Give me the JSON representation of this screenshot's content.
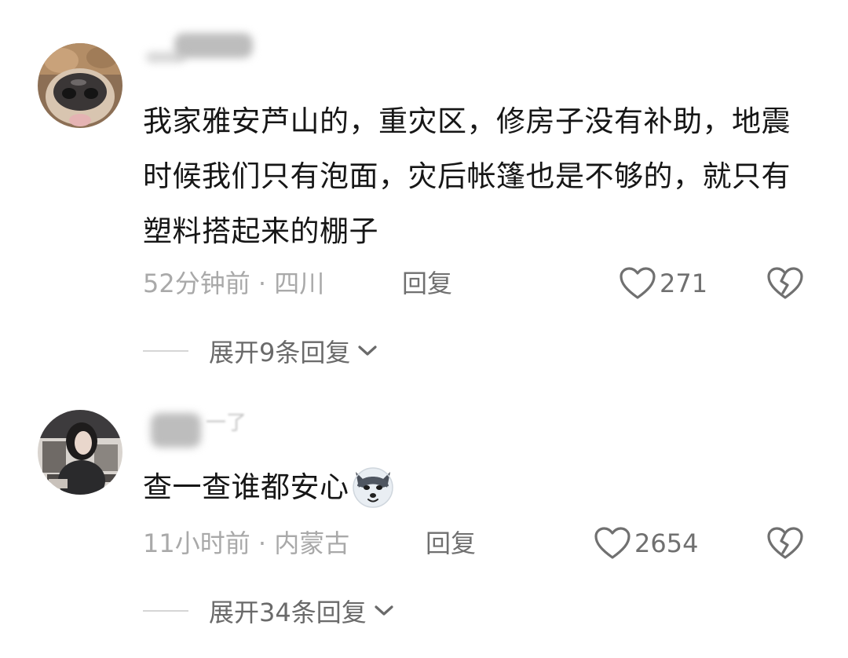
{
  "comments": [
    {
      "avatar_icon": "dog-nose-avatar",
      "content": "我家雅安芦山的，重灾区，修房子没有补助，地震时候我们只有泡面，灾后帐篷也是不够的，就只有塑料搭起来的棚子",
      "time_location": "52分钟前 · 四川",
      "reply_label": "回复",
      "like_count": "271",
      "expand_label": "展开9条回复"
    },
    {
      "avatar_icon": "girl-photo-avatar",
      "username_tail": "一了",
      "content": "查一查谁都安心",
      "content_emoji": "husky-emoji",
      "time_location": "11小时前 · 内蒙古",
      "reply_label": "回复",
      "like_count": "2654",
      "expand_label": "展开34条回复"
    }
  ],
  "colors": {
    "text_primary": "#161616",
    "text_meta": "#a9a9a9",
    "text_action": "#707070"
  }
}
